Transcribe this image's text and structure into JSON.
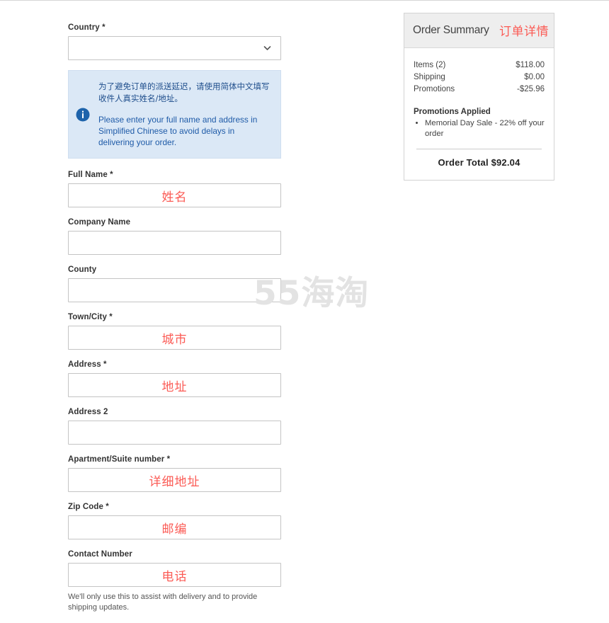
{
  "watermark": "55海淘",
  "form": {
    "fields": [
      {
        "label": "Country *",
        "type": "select",
        "value": "",
        "annotation": ""
      },
      {
        "label": "Full Name *",
        "type": "text",
        "value": "",
        "annotation": "姓名"
      },
      {
        "label": "Company Name",
        "type": "text",
        "value": "",
        "annotation": ""
      },
      {
        "label": "County",
        "type": "text",
        "value": "",
        "annotation": ""
      },
      {
        "label": "Town/City *",
        "type": "text",
        "value": "",
        "annotation": "城市"
      },
      {
        "label": "Address *",
        "type": "text",
        "value": "",
        "annotation": "地址"
      },
      {
        "label": "Address 2",
        "type": "text",
        "value": "",
        "annotation": ""
      },
      {
        "label": "Apartment/Suite number *",
        "type": "text",
        "value": "",
        "annotation": "详细地址"
      },
      {
        "label": "Zip Code *",
        "type": "text",
        "value": "",
        "annotation": "邮编"
      },
      {
        "label": "Contact Number",
        "type": "text",
        "value": "",
        "annotation": "电话"
      }
    ],
    "notice": {
      "icon": "info-icon",
      "chinese": "为了避免订单的派送延迟，请使用简体中文填写收件人真实姓名/地址。",
      "english": "Please enter your full name and address in Simplified Chinese to avoid delays in delivering your order."
    },
    "helper_text": "We'll only use this to assist with delivery and to provide shipping updates."
  },
  "summary": {
    "title": "Order Summary",
    "title_cn": "订单详情",
    "rows": [
      {
        "label": "Items (2)",
        "value": "$118.00"
      },
      {
        "label": "Shipping",
        "value": "$0.00"
      },
      {
        "label": "Promotions",
        "value": "-$25.96"
      }
    ],
    "promotions_heading": "Promotions Applied",
    "promotions": [
      "Memorial Day Sale - 22% off your order"
    ],
    "order_total": "Order Total $92.04"
  },
  "colors": {
    "accent_red": "#fb5b55",
    "notice_bg": "#dbe8f6",
    "notice_blue": "#1f5ba8",
    "header_gray": "#eeeeee"
  }
}
